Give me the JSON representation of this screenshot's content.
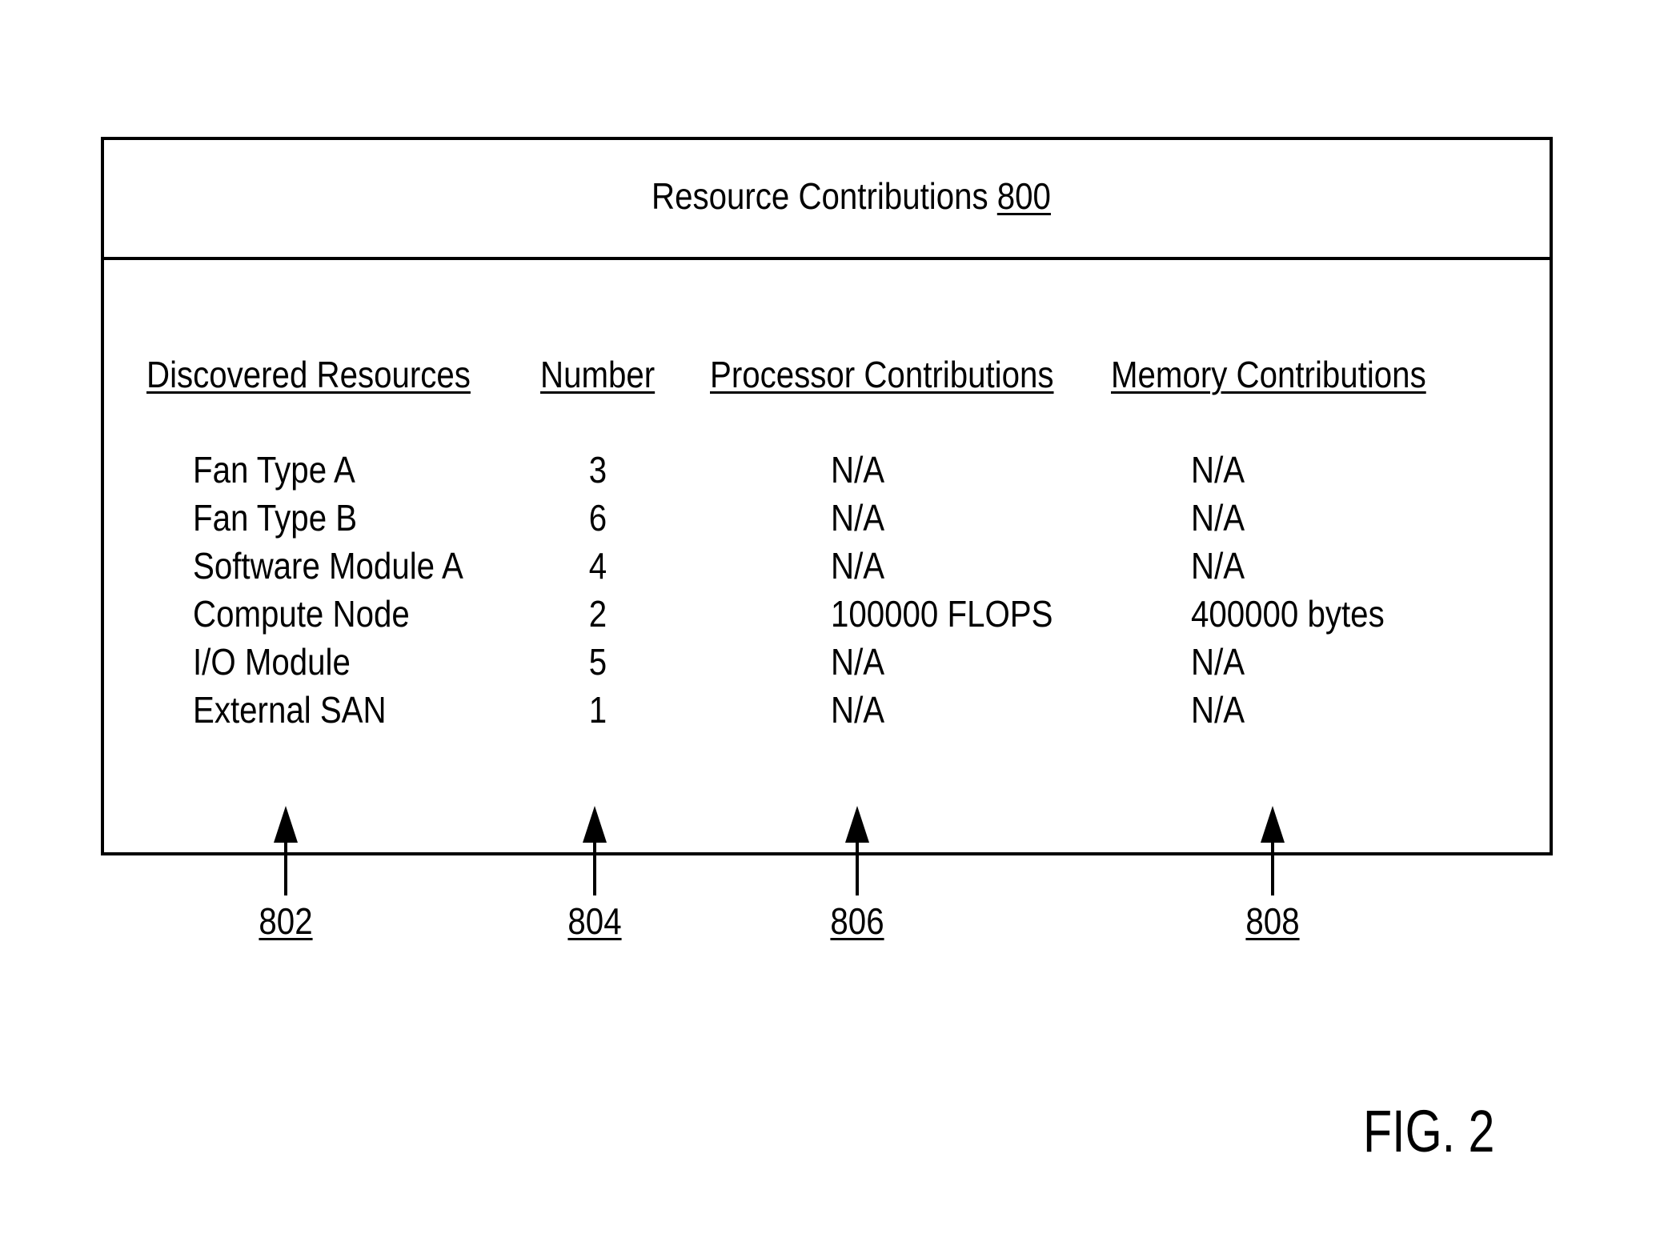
{
  "diagram": {
    "title_text": "Resource Contributions ",
    "title_ref": "800",
    "figure_label": "FIG. 2",
    "line_color": "#000000",
    "background_color": "#ffffff"
  },
  "table": {
    "headers": [
      "Discovered Resources",
      "Number",
      "Processor Contributions",
      "Memory Contributions"
    ],
    "rows": [
      {
        "resource": "Fan Type A",
        "number": "3",
        "processor": "N/A",
        "memory": "N/A"
      },
      {
        "resource": "Fan Type B",
        "number": "6",
        "processor": "N/A",
        "memory": "N/A"
      },
      {
        "resource": "Software Module A",
        "number": "4",
        "processor": "N/A",
        "memory": "N/A"
      },
      {
        "resource": "Compute Node",
        "number": "2",
        "processor": "100000 FLOPS",
        "memory": "400000 bytes"
      },
      {
        "resource": "I/O Module",
        "number": "5",
        "processor": "N/A",
        "memory": "N/A"
      },
      {
        "resource": "External SAN",
        "number": "1",
        "processor": "N/A",
        "memory": "N/A"
      }
    ]
  },
  "callouts": [
    {
      "ref": "802",
      "target": "Discovered Resources"
    },
    {
      "ref": "804",
      "target": "Number"
    },
    {
      "ref": "806",
      "target": "Processor Contributions"
    },
    {
      "ref": "808",
      "target": "Memory Contributions"
    }
  ]
}
